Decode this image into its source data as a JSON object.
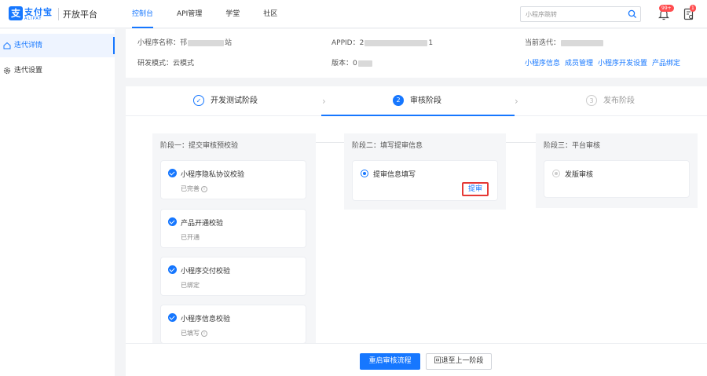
{
  "brand": {
    "logo_mark": "支",
    "name_cn": "支付宝",
    "name_en": "ALIPAY",
    "platform": "开放平台",
    "color": "#1677ff"
  },
  "nav": {
    "items": [
      {
        "label": "控制台",
        "active": true
      },
      {
        "label": "API管理",
        "active": false
      },
      {
        "label": "学堂",
        "active": false
      },
      {
        "label": "社区",
        "active": false
      }
    ]
  },
  "search": {
    "placeholder": "小程序跳转",
    "icon": "search-icon"
  },
  "notifications": {
    "bell_badge": "99+",
    "doc_badge": "1"
  },
  "sidebar": {
    "items": [
      {
        "label": "迭代详情",
        "icon": "home-icon",
        "active": true
      },
      {
        "label": "迭代设置",
        "icon": "gear-icon",
        "active": false
      }
    ]
  },
  "info": {
    "app_name_label": "小程序名称：",
    "app_name_prefix": "邗",
    "app_name_suffix": "站",
    "appid_label": "APPID：",
    "appid_prefix": "2",
    "appid_suffix": "1",
    "iteration_label": "当前迭代：",
    "mode_label": "研发模式：",
    "mode_value": "云模式",
    "version_label": "版本：",
    "version_prefix": "0",
    "links": [
      "小程序信息",
      "成员管理",
      "小程序开发设置",
      "产品绑定"
    ]
  },
  "steps": [
    {
      "number": "✓",
      "label": "开发测试阶段",
      "state": "done"
    },
    {
      "number": "2",
      "label": "审核阶段",
      "state": "active"
    },
    {
      "number": "3",
      "label": "发布阶段",
      "state": "wait"
    }
  ],
  "stage1": {
    "title": "阶段一：提交审核预校验",
    "checks": [
      {
        "title": "小程序隐私协议校验",
        "status": "已完善",
        "info": "i"
      },
      {
        "title": "产品开通校验",
        "status": "已开通"
      },
      {
        "title": "小程序交付校验",
        "status": "已绑定"
      },
      {
        "title": "小程序信息校验",
        "status": "已填写",
        "info": "i"
      }
    ]
  },
  "stage2": {
    "title": "阶段二：填写提审信息",
    "option": "提审信息填写",
    "submit": "提审"
  },
  "stage3": {
    "title": "阶段三：平台审核",
    "option": "发版审核"
  },
  "footer": {
    "restart": "重启审核流程",
    "rollback": "回退至上一阶段"
  }
}
